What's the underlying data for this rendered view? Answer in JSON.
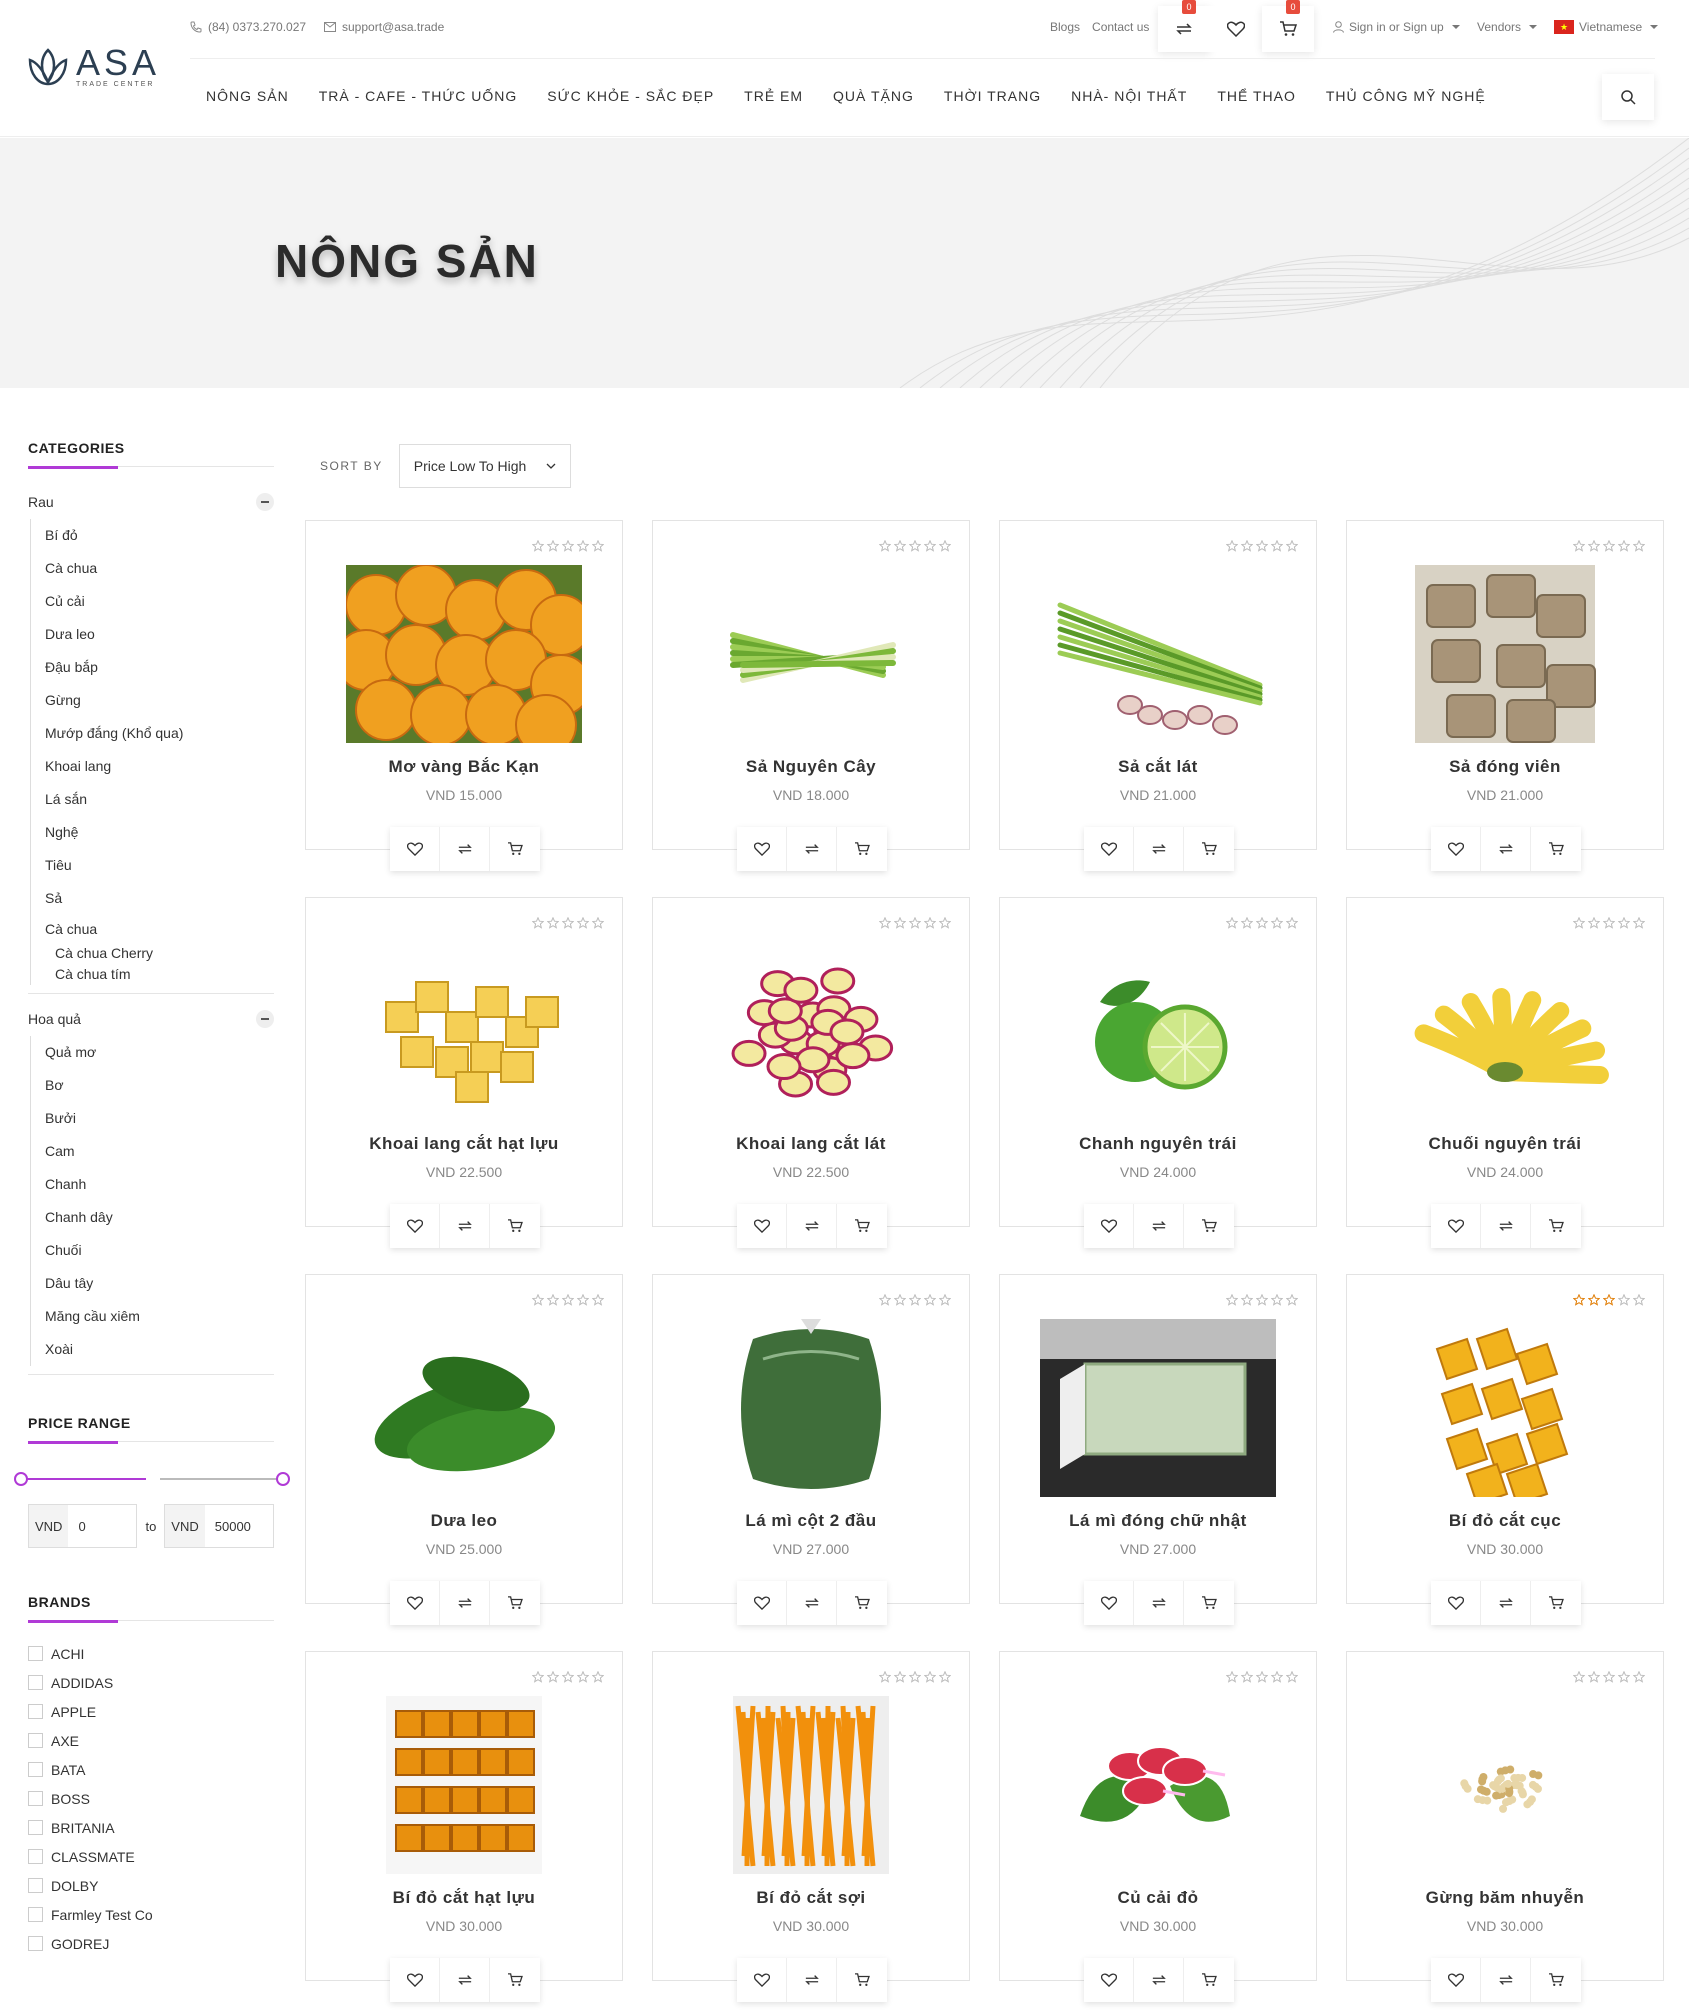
{
  "header": {
    "logo_text": "ASA",
    "logo_sub": "TRADE CENTER",
    "phone": "(84) 0373.270.027",
    "email": "support@asa.trade",
    "blogs": "Blogs",
    "contact": "Contact us",
    "compare_count": "0",
    "cart_count": "0",
    "sign_in": "Sign in or Sign up",
    "vendors": "Vendors",
    "language": "Vietnamese"
  },
  "nav": [
    "NÔNG SẢN",
    "TRÀ - CAFE - THỨC UỐNG",
    "SỨC KHỎE - SẮC ĐẸP",
    "TRẺ EM",
    "QUÀ TẶNG",
    "THỜI TRANG",
    "NHÀ- NỘI THẤT",
    "THỂ THAO",
    "THỦ CÔNG MỸ NGHỆ"
  ],
  "hero": {
    "title": "NÔNG SẢN"
  },
  "sidebar": {
    "categories_title": "CATEGORIES",
    "group1": {
      "name": "Rau",
      "items": [
        "Bí đỏ",
        "Cà chua",
        "Củ cải",
        "Dưa leo",
        "Đậu bắp",
        "Gừng",
        "Mướp đắng (Khổ qua)",
        "Khoai lang",
        "Lá sắn",
        "Nghệ",
        "Tiêu",
        "Sả",
        "Cà chua"
      ],
      "sub": [
        "Cà chua Cherry",
        "Cà chua tím"
      ]
    },
    "group2": {
      "name": "Hoa quả",
      "items": [
        "Quả mơ",
        "Bơ",
        "Bưởi",
        "Cam",
        "Chanh",
        "Chanh dây",
        "Chuối",
        "Dâu tây",
        "Măng cầu xiêm",
        "Xoài"
      ]
    },
    "price_title": "PRICE RANGE",
    "currency": "VND",
    "price_min": "0",
    "price_max": "50000",
    "to": "to",
    "brands_title": "BRANDS",
    "brands": [
      "ACHI",
      "ADDIDAS",
      "APPLE",
      "AXE",
      "BATA",
      "BOSS",
      "BRITANIA",
      "CLASSMATE",
      "DOLBY",
      "Farmley Test Co",
      "GODREJ"
    ]
  },
  "sort": {
    "label": "SORT BY",
    "value": "Price Low To High"
  },
  "products": [
    {
      "name": "Mơ vàng Bắc Kạn",
      "price": "VND 15.000",
      "rating": 0,
      "img": "apricot"
    },
    {
      "name": "Sả Nguyên Cây",
      "price": "VND 18.000",
      "rating": 0,
      "img": "lemongrass"
    },
    {
      "name": "Sả cắt lát",
      "price": "VND 21.000",
      "rating": 0,
      "img": "lemongrass-cut"
    },
    {
      "name": "Sả đóng viên",
      "price": "VND 21.000",
      "rating": 0,
      "img": "cubes-brown"
    },
    {
      "name": "Khoai lang cắt hạt lựu",
      "price": "VND 22.500",
      "rating": 0,
      "img": "cubes-yellow"
    },
    {
      "name": "Khoai lang cắt lát",
      "price": "VND 22.500",
      "rating": 0,
      "img": "slices"
    },
    {
      "name": "Chanh nguyên trái",
      "price": "VND 24.000",
      "rating": 0,
      "img": "lime"
    },
    {
      "name": "Chuối nguyên trái",
      "price": "VND 24.000",
      "rating": 0,
      "img": "banana"
    },
    {
      "name": "Dưa leo",
      "price": "VND 25.000",
      "rating": 0,
      "img": "cucumber"
    },
    {
      "name": "Lá mì cột 2 đầu",
      "price": "VND 27.000",
      "rating": 0,
      "img": "wrapped"
    },
    {
      "name": "Lá mì đóng chữ nhật",
      "price": "VND 27.000",
      "rating": 0,
      "img": "block"
    },
    {
      "name": "Bí đỏ cắt cục",
      "price": "VND 30.000",
      "rating": 3,
      "img": "pumpkin"
    },
    {
      "name": "Bí đỏ cắt hạt lựu",
      "price": "VND 30.000",
      "rating": 0,
      "img": "pumpkin-dice"
    },
    {
      "name": "Bí đỏ cắt sợi",
      "price": "VND 30.000",
      "rating": 0,
      "img": "pumpkin-strip"
    },
    {
      "name": "Củ cải đỏ",
      "price": "VND 30.000",
      "rating": 0,
      "img": "radish"
    },
    {
      "name": "Gừng băm nhuyễn",
      "price": "VND 30.000",
      "rating": 0,
      "img": "ginger"
    }
  ],
  "colors": {
    "accent": "#b03ad6",
    "badge": "#e74c3c",
    "star_on": "#e07b00"
  }
}
